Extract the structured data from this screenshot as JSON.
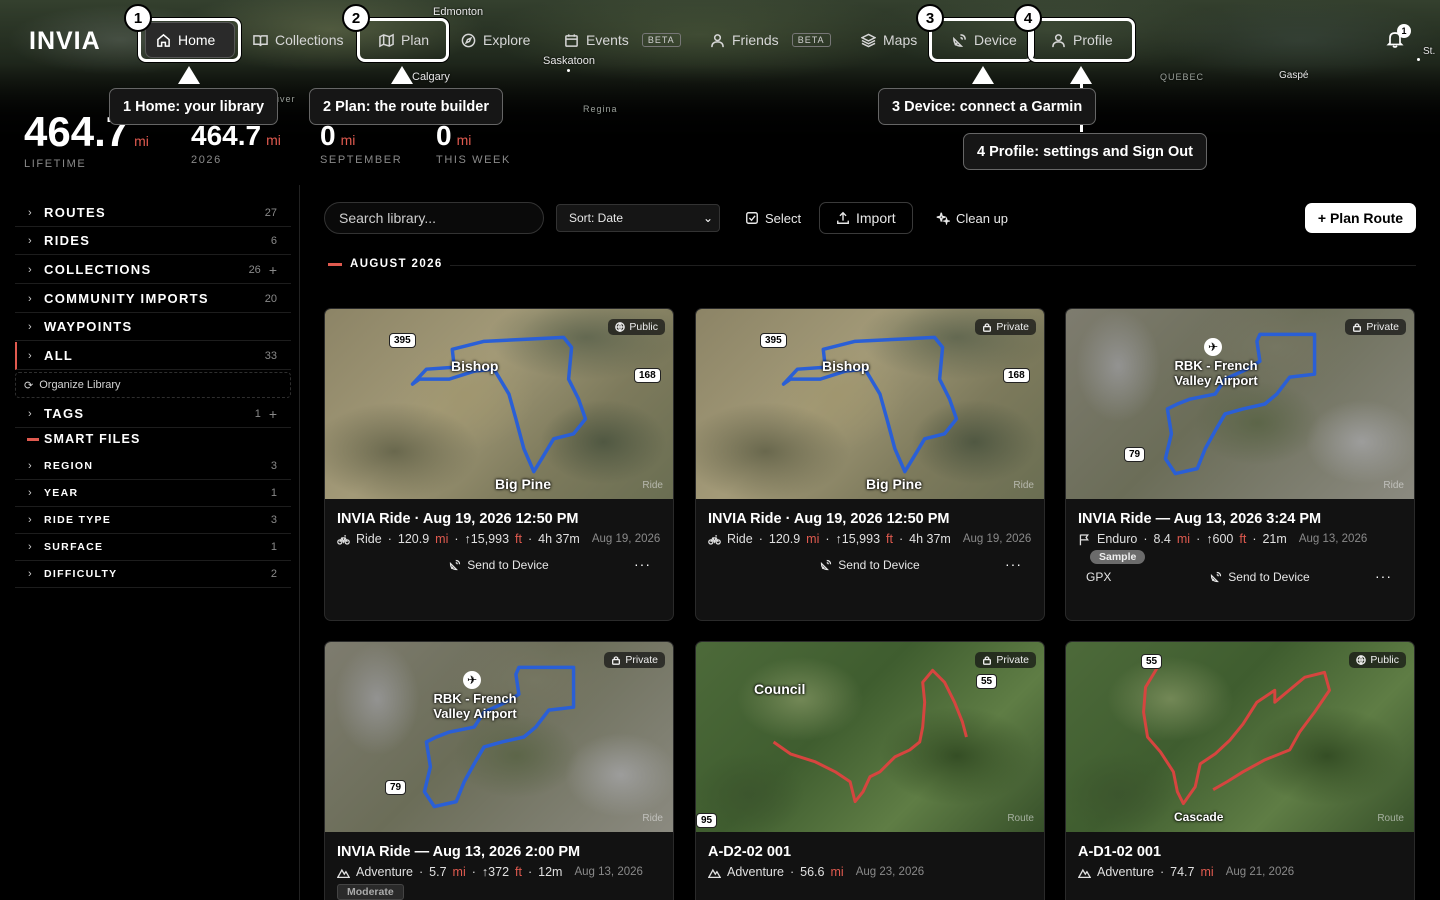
{
  "app": {
    "logo": "INVIA"
  },
  "map_labels": {
    "edmonton": "Edmonton",
    "saskatoon": "Saskatoon",
    "calgary": "Calgary",
    "regina": "Regina",
    "vancouver": "ouver",
    "quebec": "QUEBEC",
    "gaspe": "Gaspé",
    "st": "St."
  },
  "nav": {
    "home": "Home",
    "collections": "Collections",
    "plan": "Plan",
    "explore": "Explore",
    "events": "Events",
    "events_badge": "BETA",
    "friends": "Friends",
    "friends_badge": "BETA",
    "maps": "Maps",
    "device": "Device",
    "profile": "Profile"
  },
  "notifications": {
    "count": "1"
  },
  "tour": {
    "s1": "1",
    "s2": "2",
    "s3": "3",
    "s4": "4",
    "tip1": "1 Home: your library",
    "tip2": "2 Plan: the route builder",
    "tip3": "3 Device: connect a Garmin",
    "tip4": "4 Profile: settings and Sign Out"
  },
  "stats": {
    "lifetime_value": "464.7",
    "lifetime_unit": "mi",
    "lifetime_caption": "LIFETIME",
    "year_value": "464.7",
    "year_unit": "mi",
    "year_caption": "2026",
    "month_value": "0",
    "month_unit": "mi",
    "month_caption": "SEPTEMBER",
    "week_value": "0",
    "week_unit": "mi",
    "week_caption": "THIS WEEK"
  },
  "sidebar": {
    "routes": {
      "label": "ROUTES",
      "count": "27"
    },
    "rides": {
      "label": "RIDES",
      "count": "6"
    },
    "collections": {
      "label": "COLLECTIONS",
      "count": "26"
    },
    "community": {
      "label": "COMMUNITY IMPORTS",
      "count": "20"
    },
    "waypoints": {
      "label": "WAYPOINTS"
    },
    "all": {
      "label": "ALL",
      "count": "33"
    },
    "organize": "Organize Library",
    "tags": {
      "label": "TAGS",
      "count": "1"
    },
    "smart_files": "SMART FILES",
    "region": {
      "label": "REGION",
      "count": "3"
    },
    "year": {
      "label": "YEAR",
      "count": "1"
    },
    "ride_type": {
      "label": "RIDE TYPE",
      "count": "3"
    },
    "surface": {
      "label": "SURFACE",
      "count": "1"
    },
    "difficulty": {
      "label": "DIFFICULTY",
      "count": "2"
    }
  },
  "toolbar": {
    "search_placeholder": "Search library...",
    "sort": "Sort: Date",
    "select": "Select",
    "import": "Import",
    "cleanup": "Clean up",
    "plan_route": "+ Plan Route"
  },
  "section": {
    "title": "AUGUST 2026"
  },
  "cards": [
    {
      "visibility": "Public",
      "kind": "Ride",
      "title": "INVIA Ride · Aug 19, 2026 12:50 PM",
      "type": "Ride",
      "distance": "120.9",
      "unit": "mi",
      "gain": "15,993",
      "gain_unit": "ft",
      "duration": "4h 37m",
      "date": "Aug 19, 2026",
      "send": "Send to Device",
      "map": {
        "shield_a": "395",
        "shield_b": "168",
        "place_a": "Bishop",
        "place_b": "Big Pine"
      }
    },
    {
      "visibility": "Private",
      "kind": "Ride",
      "title": "INVIA Ride · Aug 19, 2026 12:50 PM",
      "type": "Ride",
      "distance": "120.9",
      "unit": "mi",
      "gain": "15,993",
      "gain_unit": "ft",
      "duration": "4h 37m",
      "date": "Aug 19, 2026",
      "send": "Send to Device",
      "map": {
        "shield_a": "395",
        "shield_b": "168",
        "place_a": "Bishop",
        "place_b": "Big Pine"
      }
    },
    {
      "visibility": "Private",
      "kind": "Ride",
      "title": "INVIA Ride — Aug 13, 2026 3:24 PM",
      "type": "Enduro",
      "distance": "8.4",
      "unit": "mi",
      "gain": "600",
      "gain_unit": "ft",
      "duration": "21m",
      "date": "Aug 13, 2026",
      "tag": "Sample",
      "gpx": "GPX",
      "send": "Send to Device",
      "map": {
        "shield_a": "79",
        "place_a": "RBK - French Valley Airport"
      }
    },
    {
      "visibility": "Private",
      "kind": "Ride",
      "title": "INVIA Ride — Aug 13, 2026 2:00 PM",
      "type": "Adventure",
      "distance": "5.7",
      "unit": "mi",
      "gain": "372",
      "gain_unit": "ft",
      "duration": "12m",
      "date": "Aug 13, 2026",
      "tag": "Moderate",
      "map": {
        "shield_a": "79",
        "place_a": "RBK - French Valley Airport"
      }
    },
    {
      "visibility": "Private",
      "kind": "Route",
      "title": "A-D2-02 001",
      "type": "Adventure",
      "distance": "56.6",
      "unit": "mi",
      "date": "Aug 23, 2026",
      "map": {
        "shield_a": "55",
        "shield_b": "95",
        "place_a": "Council"
      }
    },
    {
      "visibility": "Public",
      "kind": "Route",
      "title": "A-D1-02 001",
      "type": "Adventure",
      "distance": "74.7",
      "unit": "mi",
      "date": "Aug 21, 2026",
      "map": {
        "shield_a": "55",
        "place_a": "Cascade"
      }
    }
  ]
}
